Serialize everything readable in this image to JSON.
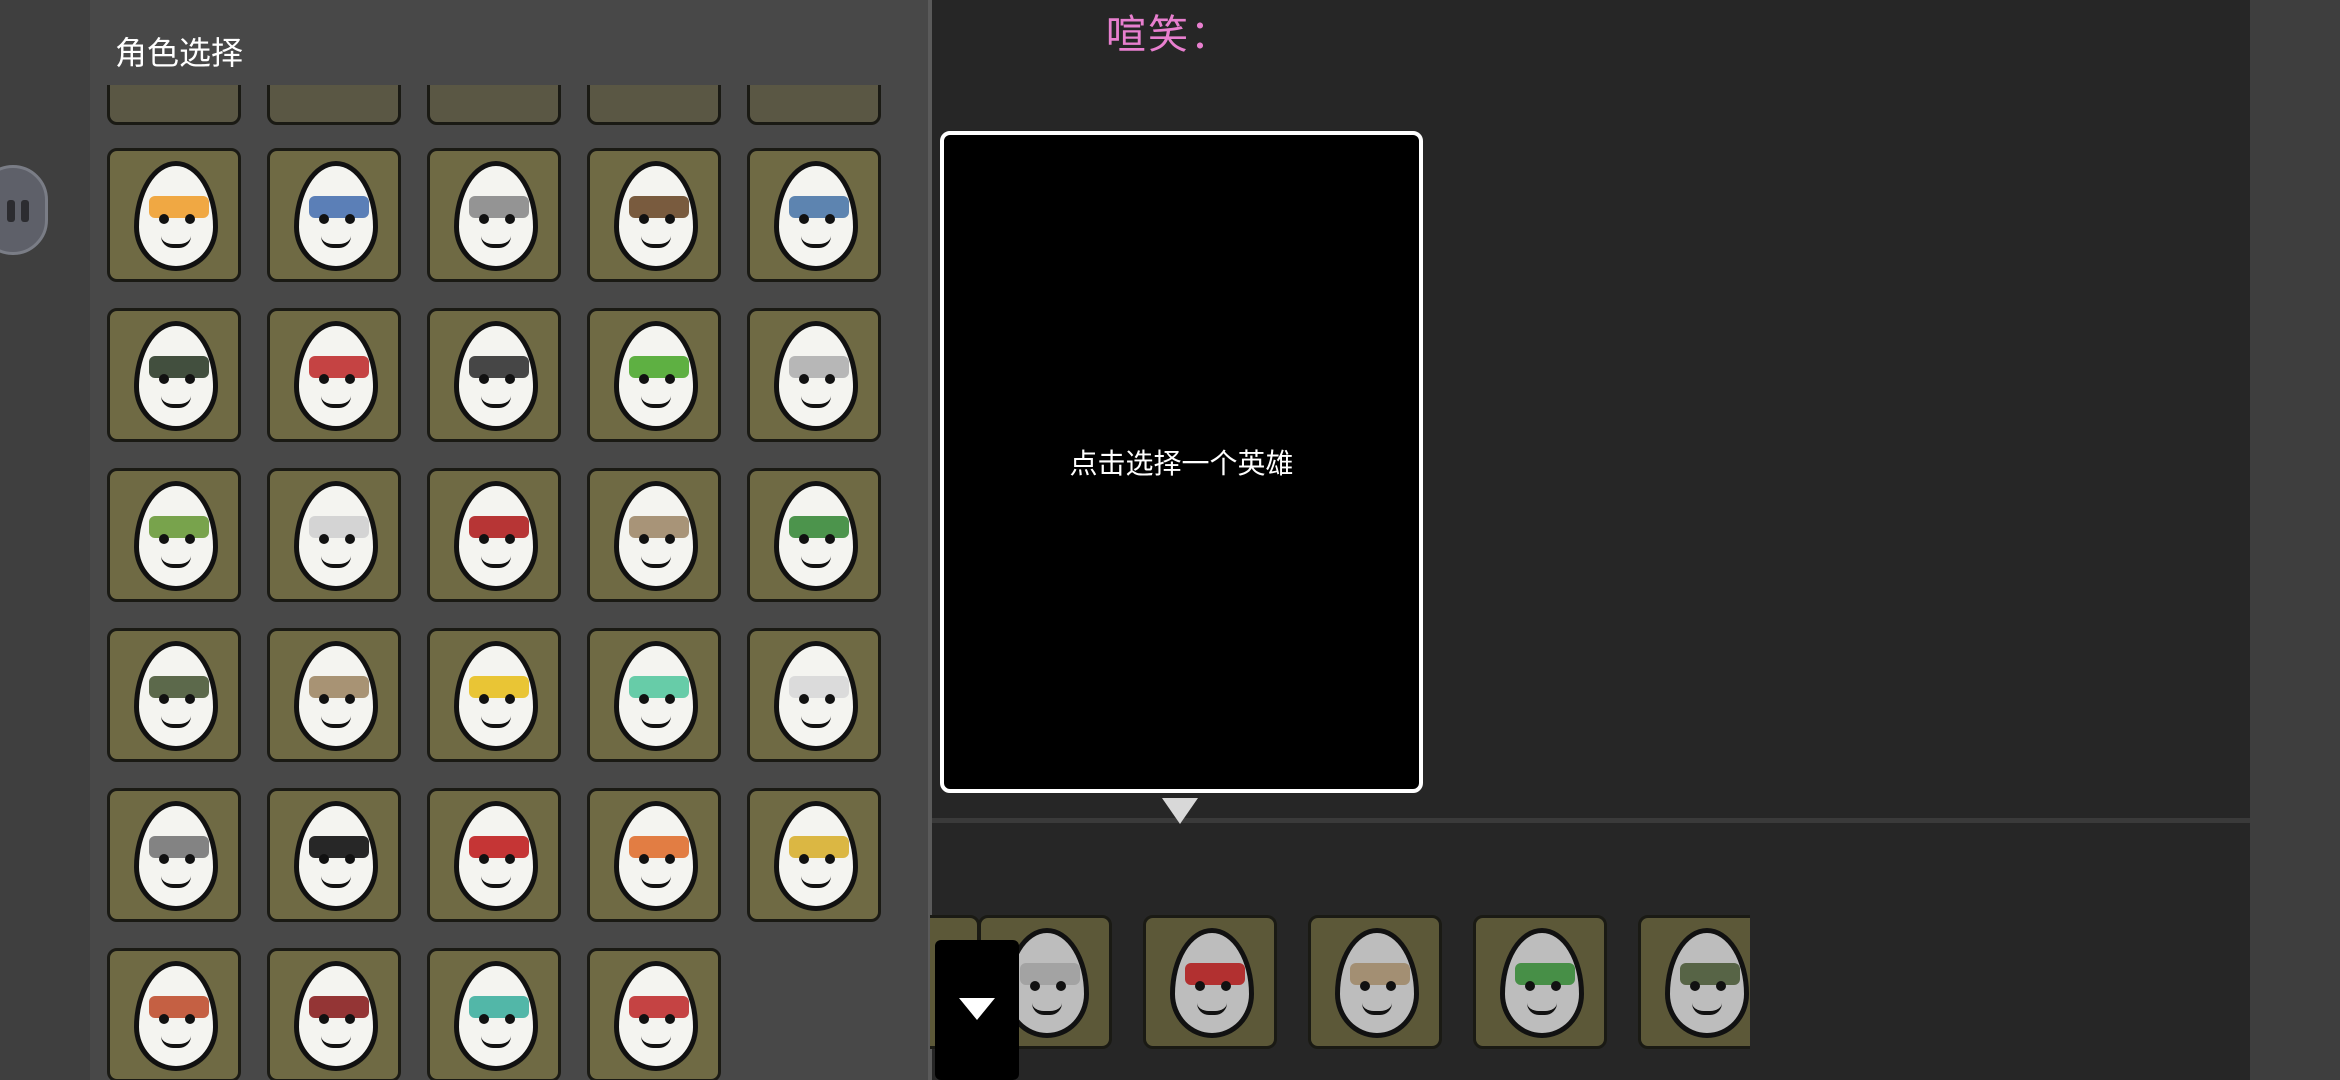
{
  "panel": {
    "title": "角色选择"
  },
  "chat": {
    "label": "喧笑："
  },
  "preview": {
    "placeholder": "点击选择一个英雄"
  },
  "heroes": [
    {
      "id": "h1",
      "accent": "#f0a030"
    },
    {
      "id": "h2",
      "accent": "#4a72b0"
    },
    {
      "id": "h3",
      "accent": "#8a8a8a"
    },
    {
      "id": "h4",
      "accent": "#6b4a2a"
    },
    {
      "id": "h5",
      "accent": "#4d78a8"
    },
    {
      "id": "h6",
      "accent": "#2f3d2a"
    },
    {
      "id": "h7",
      "accent": "#c03030"
    },
    {
      "id": "h8",
      "accent": "#333333"
    },
    {
      "id": "h9",
      "accent": "#4ea82f"
    },
    {
      "id": "h10",
      "accent": "#b0b0b0"
    },
    {
      "id": "h11",
      "accent": "#6a9a3a"
    },
    {
      "id": "h12",
      "accent": "#d0d0d0"
    },
    {
      "id": "h13",
      "accent": "#b02020"
    },
    {
      "id": "h14",
      "accent": "#a08a6a"
    },
    {
      "id": "h15",
      "accent": "#3a8a3a"
    },
    {
      "id": "h16",
      "accent": "#4b5a38"
    },
    {
      "id": "h17",
      "accent": "#a08866"
    },
    {
      "id": "h18",
      "accent": "#e8c020"
    },
    {
      "id": "h19",
      "accent": "#58c8a0"
    },
    {
      "id": "h20",
      "accent": "#d8d8d8"
    },
    {
      "id": "h21",
      "accent": "#777777"
    },
    {
      "id": "h22",
      "accent": "#111111"
    },
    {
      "id": "h23",
      "accent": "#c02020"
    },
    {
      "id": "h24",
      "accent": "#e07030"
    },
    {
      "id": "h25",
      "accent": "#d8b030"
    },
    {
      "id": "h26",
      "accent": "#c05030"
    },
    {
      "id": "h27",
      "accent": "#8a2020"
    },
    {
      "id": "h28",
      "accent": "#40b0a0"
    },
    {
      "id": "h29",
      "accent": "#c03030"
    }
  ],
  "selected_strip": [
    {
      "id": "s1",
      "accent": "#a0a0a0"
    },
    {
      "id": "s2",
      "accent": "#b02020"
    },
    {
      "id": "s3",
      "accent": "#a08a6a"
    },
    {
      "id": "s4",
      "accent": "#3a8a3a"
    },
    {
      "id": "s5",
      "accent": "#4b5a38"
    }
  ],
  "icons": {
    "float_button": "pause-icon",
    "preview_arrow": "triangle-down-icon",
    "collapse": "chevron-down-icon"
  }
}
